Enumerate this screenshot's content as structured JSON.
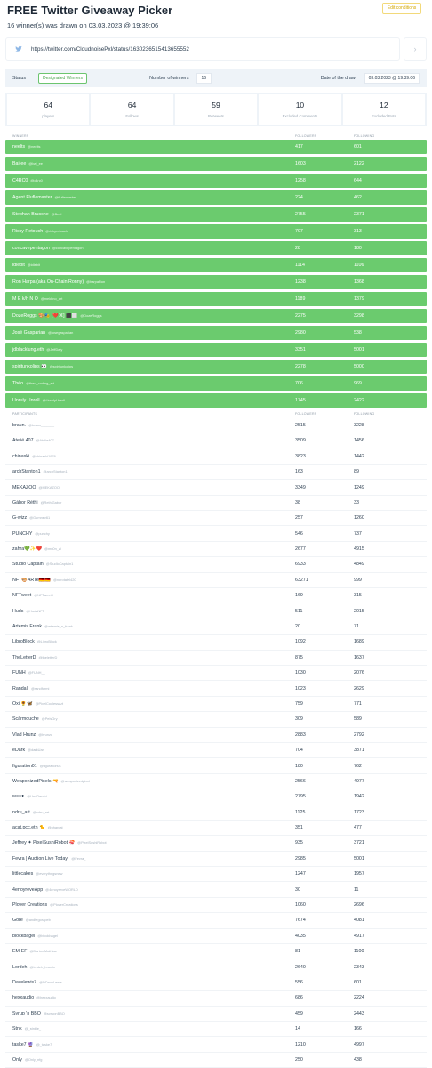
{
  "header": {
    "title": "FREE Twitter Giveaway Picker",
    "subtitle": "16 winner(s) was drawn on 03.03.2023 @ 19:39:06",
    "edit_label": "Edit conditions"
  },
  "tweet": {
    "url": "https://twitter.com/CloudnoisePxl/status/1630236515413655552"
  },
  "status_bar": {
    "status_label": "Status",
    "status_value": "Designated Winners",
    "winners_label": "Number of winners",
    "winners_value": "16",
    "date_label": "Date of the draw",
    "date_value": "03.03.2023 @ 19:39:06"
  },
  "stats": [
    {
      "value": "64",
      "label": "players"
    },
    {
      "value": "64",
      "label": "Follows"
    },
    {
      "value": "59",
      "label": "Retweets"
    },
    {
      "value": "10",
      "label": "Excluded Comments"
    },
    {
      "value": "12",
      "label": "Excluded Bots"
    }
  ],
  "colors": {
    "winner_row": "#6bcb6e",
    "accent_badge": "#4ba64e",
    "edit_button": "#d4a800"
  },
  "winners_table": {
    "headers": [
      "WINNERS",
      "FOLLOWERS",
      "FOLLOWING"
    ],
    "rows": [
      {
        "name": "neelts",
        "handle": "@neelts",
        "followers": "417",
        "following": "601"
      },
      {
        "name": "Bai-ee",
        "handle": "@bai_ee",
        "followers": "1603",
        "following": "2122"
      },
      {
        "name": "C4RC0",
        "handle": "@c4rc0",
        "followers": "1258",
        "following": "644"
      },
      {
        "name": "Agent Fluflemaster",
        "handle": "@fluflemaster",
        "followers": "224",
        "following": "462"
      },
      {
        "name": "Stephan Brusche",
        "handle": "@Beel",
        "followers": "2755",
        "following": "2371"
      },
      {
        "name": "Ricky Retouch",
        "handle": "@rickyretouch",
        "followers": "707",
        "following": "313"
      },
      {
        "name": "concavepentagon",
        "handle": "@concavepentagon",
        "followers": "28",
        "following": "180"
      },
      {
        "name": "idlebit",
        "handle": "@idlebit",
        "followers": "1114",
        "following": "1106"
      },
      {
        "name": "Ron Harpa (aka On-Chain Ronny)",
        "handle": "@harpaRon",
        "followers": "1238",
        "following": "1368"
      },
      {
        "name": "M E k/h N O",
        "handle": "@mekhno_art",
        "followers": "1189",
        "following": "1379"
      },
      {
        "name": "DozeRoggs 🎨🎭 [❤️⌘] ⬛⬜",
        "handle": "@DozeRoggs",
        "followers": "2275",
        "following": "3298"
      },
      {
        "name": "José Gasparian",
        "handle": "@josegasparian",
        "followers": "2980",
        "following": "538"
      },
      {
        "name": "jdblacklung.eth",
        "handle": "@JeffDaly",
        "followers": "3351",
        "following": "5001"
      },
      {
        "name": "spiritunkolips 👀",
        "handle": "@spiritunkolips",
        "followers": "2278",
        "following": "5000"
      },
      {
        "name": "Théo",
        "handle": "@theo_coding_art",
        "followers": "706",
        "following": "969"
      },
      {
        "name": "Unruly Unroll",
        "handle": "@UnrulyUnroll",
        "followers": "1745",
        "following": "2422"
      }
    ]
  },
  "participants_table": {
    "headers": [
      "PARTICIPANTS",
      "FOLLOWERS",
      "FOLLOWING"
    ],
    "rows": [
      {
        "name": "braun.",
        "handle": "@braun_______",
        "followers": "2515",
        "following": "3228"
      },
      {
        "name": "Atelié 407",
        "handle": "@Atelie407",
        "followers": "3509",
        "following": "1456"
      },
      {
        "name": "chinaski",
        "handle": "@chinaski1976",
        "followers": "3823",
        "following": "1442"
      },
      {
        "name": "archStanton1",
        "handle": "@archStanton1",
        "followers": "163",
        "following": "89"
      },
      {
        "name": "MEKAZOO",
        "handle": "@MEKAZOO",
        "followers": "3349",
        "following": "1249"
      },
      {
        "name": "Gábor Réthi",
        "handle": "@RethiGabor",
        "followers": "38",
        "following": "33"
      },
      {
        "name": "G-wizz",
        "handle": "@Gumnev61",
        "followers": "257",
        "following": "1260"
      },
      {
        "name": "PUNCHY",
        "handle": "@punchy",
        "followers": "546",
        "following": "737"
      },
      {
        "name": "zahra💚✨❤️",
        "handle": "@mn0n_zi",
        "followers": "2677",
        "following": "4915"
      },
      {
        "name": "Studio Captain",
        "handle": "@StudioCaptain1",
        "followers": "6933",
        "following": "4849"
      },
      {
        "name": "NFT🎨ARTe🇩🇪🇩🇪",
        "handle": "@nerotatel420",
        "followers": "63271",
        "following": "999"
      },
      {
        "name": "NFTweet",
        "handle": "@NFTweet9",
        "followers": "169",
        "following": "315"
      },
      {
        "name": "Huds",
        "handle": "@HudsNFT",
        "followers": "511",
        "following": "2015"
      },
      {
        "name": "Artemis Frank",
        "handle": "@artemis_n_frank",
        "followers": "20",
        "following": "71"
      },
      {
        "name": "LibroBlock",
        "handle": "@LibroBlock",
        "followers": "1092",
        "following": "1689"
      },
      {
        "name": "TheLetterD",
        "handle": "@theletterD",
        "followers": "875",
        "following": "1637"
      },
      {
        "name": "FUNH",
        "handle": "@FUNH__",
        "followers": "1030",
        "following": "2076"
      },
      {
        "name": "Randall",
        "handle": "@randformi",
        "followers": "1023",
        "following": "2629"
      },
      {
        "name": "Oxi 🌻🦋",
        "handle": "@PixelCoolessArt",
        "followers": "759",
        "following": "771"
      },
      {
        "name": "Scārmouche",
        "handle": "@PelsGry",
        "followers": "309",
        "following": "589"
      },
      {
        "name": "Vlad Hrunz",
        "handle": "@hrunzo",
        "followers": "2883",
        "following": "2792"
      },
      {
        "name": "eDark",
        "handle": "@darkUar",
        "followers": "704",
        "following": "3871"
      },
      {
        "name": "figuration01",
        "handle": "@figuration01",
        "followers": "180",
        "following": "762"
      },
      {
        "name": "WeaponizedPixels 🔫",
        "handle": "@weaponizedpixel",
        "followers": "2566",
        "following": "4977"
      },
      {
        "name": "w≡≡ᴥ",
        "handle": "@UnoDerchi",
        "followers": "2795",
        "following": "1942"
      },
      {
        "name": "ndru_art",
        "handle": "@ndru_art",
        "followers": "1125",
        "following": "1723"
      },
      {
        "name": "acat.pcc.eth 🐈",
        "handle": "@nharcat",
        "followers": "351",
        "following": "477"
      },
      {
        "name": "Jeffrey ✦ PixelSushiRobot 🍣",
        "handle": "@PixelSushiRobot",
        "followers": "935",
        "following": "3721"
      },
      {
        "name": "Fevra | Auction Live Today!",
        "handle": "@Fevra_",
        "followers": "2985",
        "following": "5001"
      },
      {
        "name": "littlecakes",
        "handle": "@everythngsnew",
        "followers": "1247",
        "following": "1957"
      },
      {
        "name": "4enoyreveApp",
        "handle": "@4enoyreveWORLD",
        "followers": "30",
        "following": "11"
      },
      {
        "name": "Plover Creations",
        "handle": "@PloverCreations",
        "followers": "1060",
        "following": "2696"
      },
      {
        "name": "Gore",
        "handle": "@andtegorapeb",
        "followers": "7674",
        "following": "4081"
      },
      {
        "name": "blockbagel",
        "handle": "@blockbagel",
        "followers": "4035",
        "following": "4917"
      },
      {
        "name": "EM-EF",
        "handle": "@DariumMathias",
        "followers": "81",
        "following": "1100"
      },
      {
        "name": "Lordeh",
        "handle": "@lordeh_brumic",
        "followers": "2640",
        "following": "2343"
      },
      {
        "name": "Davelewis7",
        "handle": "@DDaveLewis",
        "followers": "556",
        "following": "601"
      },
      {
        "name": "hexxaudio",
        "handle": "@hexxaudio",
        "followers": "686",
        "following": "2224"
      },
      {
        "name": "Syrup 'n BBQ",
        "handle": "@syrupnBBQ",
        "followers": "459",
        "following": "2443"
      },
      {
        "name": "Stnk",
        "handle": "@_stnkle_",
        "followers": "14",
        "following": "166"
      },
      {
        "name": "taske7 🔮",
        "handle": "@_taske7",
        "followers": "1210",
        "following": "4997"
      },
      {
        "name": "Only",
        "handle": "@Only_nfg",
        "followers": "250",
        "following": "438"
      }
    ]
  }
}
